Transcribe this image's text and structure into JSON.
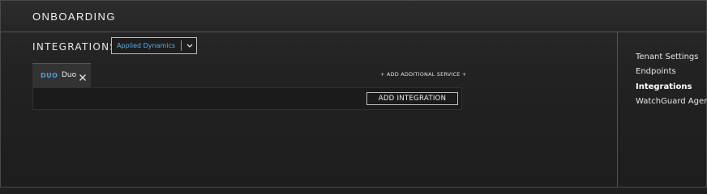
{
  "header": {
    "title": "ONBOARDING"
  },
  "section": {
    "title": "INTEGRATIONS"
  },
  "dropdown": {
    "selected": "Applied Dynamics"
  },
  "tabs": [
    {
      "logo": "DUO",
      "label": "Duo"
    }
  ],
  "actions": {
    "add_service": "+ ADD ADDITIONAL SERVICE +",
    "add_integration": "ADD INTEGRATION"
  },
  "sidebar": {
    "items": [
      {
        "label": "Tenant Settings",
        "active": false
      },
      {
        "label": "Endpoints",
        "active": false
      },
      {
        "label": "Integrations",
        "active": true
      },
      {
        "label": "WatchGuard Agent",
        "active": false
      }
    ]
  },
  "colors": {
    "accent": "#5ab0e6",
    "background": "#1f1f1f",
    "text": "#e6e6e6"
  },
  "icons": {
    "dropdown": "chevron-down-icon",
    "tab_close": "close-icon",
    "tab_logo": "duo-logo"
  }
}
